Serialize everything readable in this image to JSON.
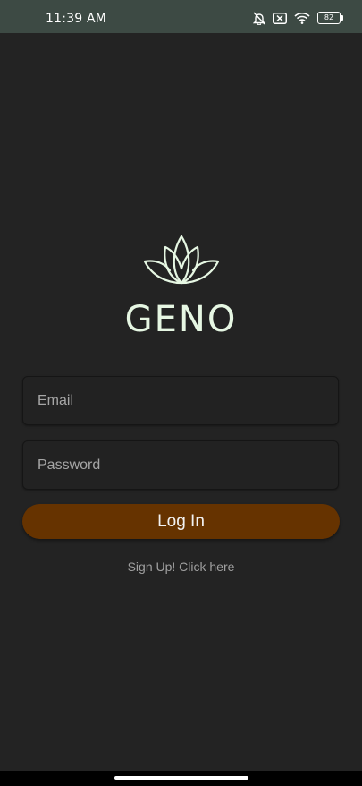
{
  "status_bar": {
    "time": "11:39 AM",
    "battery": "82",
    "icons": [
      "bell-muted-icon",
      "sim-x-icon",
      "wifi-icon",
      "battery-icon"
    ]
  },
  "app": {
    "brand": "GENO",
    "logo_icon": "lotus-icon",
    "accent_color": "#e6f7e3"
  },
  "form": {
    "email_placeholder": "Email",
    "password_placeholder": "Password",
    "login_label": "Log In",
    "login_color": "#663300",
    "signup_text": "Sign Up! Click here"
  }
}
